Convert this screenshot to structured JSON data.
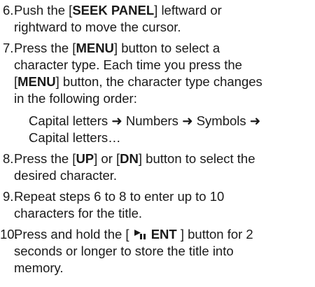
{
  "steps": [
    {
      "number": "6.",
      "text_before": "Push the [",
      "key": "SEEK PANEL",
      "text_after": "] leftward or",
      "line2": "rightward to move the cursor."
    },
    {
      "number": "7.",
      "l1_before": "Press the [",
      "l1_key": "MENU",
      "l1_after": "] button to select a",
      "l2": "character type. Each time you press the",
      "l3_open": "[",
      "l3_key": "MENU",
      "l3_after": "] button, the character type changes",
      "l4": "in the following order:",
      "order_line1": "Capital letters ➜ Numbers ➜ Symbols ➜",
      "order_line2": "Capital letters…"
    },
    {
      "number": "8.",
      "l1_before": "Press the [",
      "l1_key1": "UP",
      "l1_mid": "] or [",
      "l1_key2": "DN",
      "l1_after": "] button to select the",
      "l2": "desired character."
    },
    {
      "number": "9.",
      "l1": "Repeat steps 6 to 8 to enter up to 10",
      "l2": "characters for the title."
    },
    {
      "number": "10.",
      "l1_before": "Press and hold the [ ",
      "icon": "play-pause-icon",
      "l1_key": "ENT",
      "l1_after": " ] button for 2",
      "l2": "seconds or longer to store the title into",
      "l3": "memory."
    }
  ]
}
